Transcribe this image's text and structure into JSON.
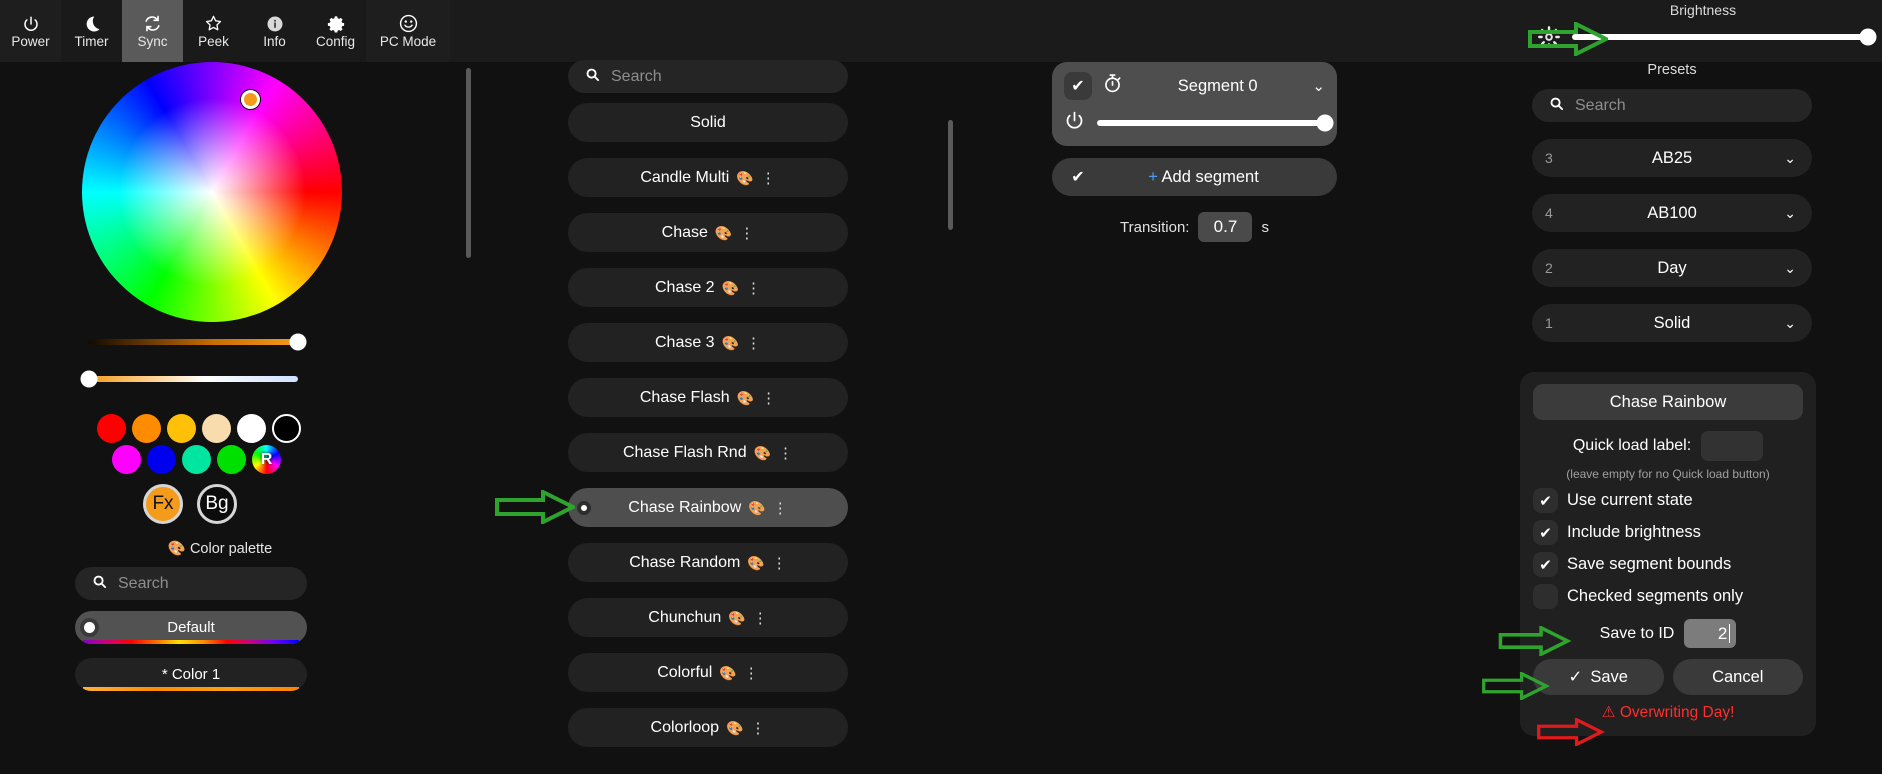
{
  "topnav": {
    "items": [
      {
        "label": "Power",
        "icon": "power-icon"
      },
      {
        "label": "Timer",
        "icon": "moon-icon"
      },
      {
        "label": "Sync",
        "icon": "sync-icon"
      },
      {
        "label": "Peek",
        "icon": "star-icon"
      },
      {
        "label": "Info",
        "icon": "info-icon"
      },
      {
        "label": "Config",
        "icon": "gear-icon"
      },
      {
        "label": "PC Mode",
        "icon": "smiley-icon"
      }
    ],
    "active": "Sync"
  },
  "brightness": {
    "label": "Brightness",
    "icon": "sun-icon",
    "value": 100
  },
  "colorpicker": {
    "wheel_marker_color": "#f59b1c",
    "slider_value": 100,
    "slider_whitebalance": 0,
    "swatches_row1": [
      "#ff0000",
      "#ff8c00",
      "#ffc107",
      "#f8dcad",
      "#ffffff",
      "#000000"
    ],
    "swatches_row2": [
      "#ff00ff",
      "#0000ee",
      "#00e6a0",
      "#00e000",
      "rainbow"
    ],
    "rainbow_swatch_label": "R",
    "fx_button": "Fx",
    "bg_button": "Bg"
  },
  "palette": {
    "heading": "Color palette",
    "heading_icon": "palette-icon",
    "search_placeholder": "Search",
    "items": [
      {
        "label": "Default",
        "selected": true,
        "bar": "rainbow"
      },
      {
        "label": "* Color 1",
        "selected": false,
        "bar": "orange"
      }
    ]
  },
  "effects": {
    "search_placeholder": "Search",
    "items": [
      {
        "label": "Solid",
        "palette": false,
        "selected": false
      },
      {
        "label": "Candle Multi",
        "palette": true,
        "selected": false
      },
      {
        "label": "Chase",
        "palette": true,
        "selected": false
      },
      {
        "label": "Chase 2",
        "palette": true,
        "selected": false
      },
      {
        "label": "Chase 3",
        "palette": true,
        "selected": false
      },
      {
        "label": "Chase Flash",
        "palette": true,
        "selected": false
      },
      {
        "label": "Chase Flash Rnd",
        "palette": true,
        "selected": false
      },
      {
        "label": "Chase Rainbow",
        "palette": true,
        "selected": true
      },
      {
        "label": "Chase Random",
        "palette": true,
        "selected": false
      },
      {
        "label": "Chunchun",
        "palette": true,
        "selected": false
      },
      {
        "label": "Colorful",
        "palette": true,
        "selected": false
      },
      {
        "label": "Colorloop",
        "palette": true,
        "selected": false
      }
    ]
  },
  "segments": {
    "segment": {
      "name": "Segment 0",
      "checked": true,
      "timer_icon": "stopwatch-icon",
      "power_icon": "power-icon",
      "chevron": "chevron-down-icon",
      "brightness": 100
    },
    "add_segment": {
      "label": "Add segment",
      "plus": "+",
      "checked": true
    },
    "transition": {
      "label": "Transition:",
      "value": "0.7",
      "unit": "s"
    }
  },
  "presets": {
    "heading": "Presets",
    "search_placeholder": "Search",
    "items": [
      {
        "id": "3",
        "name": "AB25"
      },
      {
        "id": "4",
        "name": "AB100"
      },
      {
        "id": "2",
        "name": "Day"
      },
      {
        "id": "1",
        "name": "Solid"
      }
    ]
  },
  "save_panel": {
    "preset_name": "Chase Rainbow",
    "quick_load_label": "Quick load label:",
    "quick_load_value": "",
    "quick_load_hint": "(leave empty for no Quick load button)",
    "checkboxes": [
      {
        "label": "Use current state",
        "checked": true
      },
      {
        "label": "Include brightness",
        "checked": true
      },
      {
        "label": "Save segment bounds",
        "checked": true
      },
      {
        "label": "Checked segments only",
        "checked": false
      }
    ],
    "save_to_id_label": "Save to ID",
    "save_to_id_value": "2",
    "save_button": "Save",
    "cancel_button": "Cancel",
    "warning": "Overwriting Day!",
    "warning_icon": "warning-triangle-icon",
    "warning_color": "#ff2e2e"
  },
  "annotations": {
    "arrow_color_green": "#2ea32e",
    "arrow_color_red": "#e01b1b",
    "arrows": [
      {
        "name": "arrow-to-brightness-icon",
        "color": "green"
      },
      {
        "name": "arrow-to-chase-rainbow",
        "color": "green"
      },
      {
        "name": "arrow-to-save-to-id",
        "color": "green"
      },
      {
        "name": "arrow-to-save-button",
        "color": "green"
      },
      {
        "name": "arrow-to-overwrite-warning",
        "color": "red"
      }
    ]
  }
}
